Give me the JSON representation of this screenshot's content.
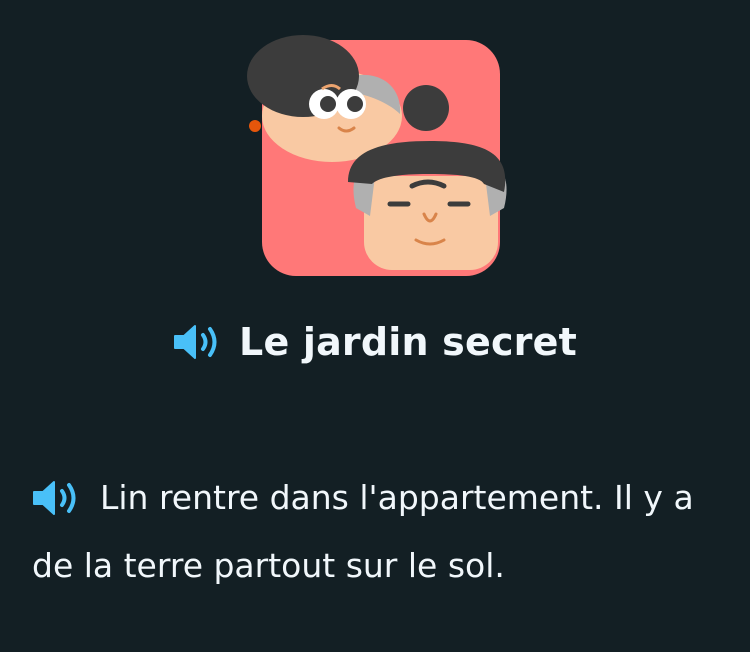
{
  "story": {
    "title": "Le jardin secret",
    "line1": "Lin rentre dans l'appartement. Il y a",
    "line2": "de la terre partout sur le sol."
  },
  "icons": {
    "title_speaker": "speaker-icon",
    "line_speaker": "speaker-icon"
  },
  "colors": {
    "background": "#131f24",
    "text": "#f1f7fb",
    "speaker_blue": "#49c0f8",
    "card_coral": "#ff7878",
    "skin": "#f9c9a3",
    "hair": "#3c3c3c"
  }
}
